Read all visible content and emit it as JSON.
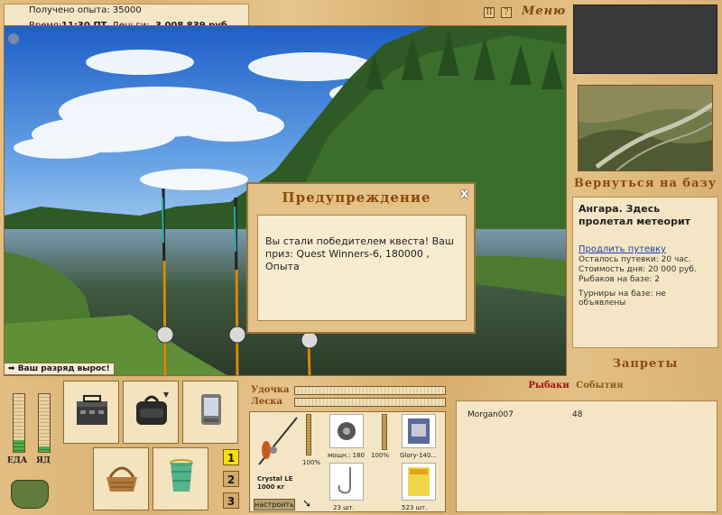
{
  "status": {
    "experience_label": "Получено опыта: 35000",
    "time_label": "Время:",
    "time_value": "11:30 ПТ",
    "money_label": "Деньги:",
    "money_value": "3 008 839 руб."
  },
  "topbar": {
    "pause_label": "II",
    "help_label": "?",
    "menu_label": "Меню"
  },
  "right_panel": {
    "return_label": "Вернуться на базу",
    "base_title": "Ангара. Здесь пролетал метеорит",
    "extend_link": "Продлить путевку",
    "lines": [
      "Осталось путевки: 20 час.",
      "Стоимость дня: 20 000 руб.",
      "Рыбаков на базе: 2",
      "Турниры на базе: не объявлены"
    ],
    "bans_label": "Запреты"
  },
  "popup": {
    "title": "Предупреждение",
    "close_label": "x",
    "message": "Вы стали победителем квеста! Ваш приз: Quest Winners-6, 180000 , Опыта"
  },
  "notice": {
    "rank_up": "Ваш разряд вырос!"
  },
  "meters": {
    "food_label": "ЕДА",
    "food_level": 0.2,
    "drink_label": "ЯД",
    "drink_level": 0.1
  },
  "tabs": {
    "items": [
      "1",
      "2",
      "3"
    ],
    "active": "1"
  },
  "tackle": {
    "rod_label": "Удочка",
    "line_label": "Леска",
    "rod_name": "Crystal LE",
    "rod_weight": "1000 кг",
    "rod_percent": "100%",
    "reel_caption": "мощн.: 180",
    "reel_percent": "100%",
    "bait_caption": "Glory-140...",
    "hook_count": "23 шт.",
    "bait_count": "523 шт.",
    "setup_label": "настроить"
  },
  "events": {
    "fishers_label": "Рыбаки",
    "events_label": "События",
    "rows": [
      {
        "name": "Morgan007",
        "value": "48"
      }
    ]
  },
  "colors": {
    "title_brown": "#8c4a08",
    "link_blue": "#1a3fb0",
    "active_tab": "#f5e200",
    "meter_green": "#4eae4a"
  }
}
